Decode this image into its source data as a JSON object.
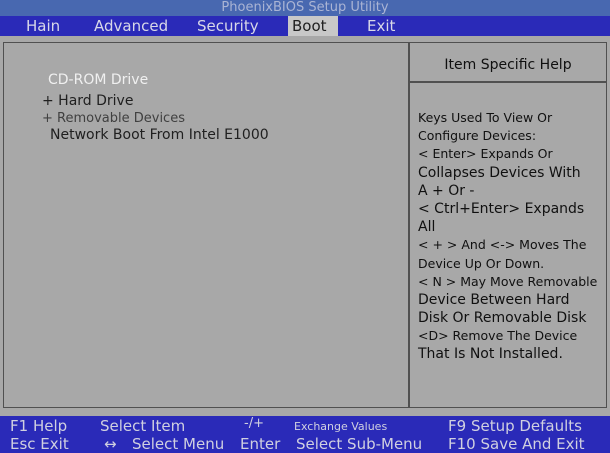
{
  "window": {
    "title": "PhoenixBIOS Setup Utility"
  },
  "menu": {
    "items": [
      {
        "label": "Hain"
      },
      {
        "label": "Advanced"
      },
      {
        "label": "Security"
      },
      {
        "label": "Boot"
      },
      {
        "label": "Exit"
      }
    ],
    "active": "Boot"
  },
  "boot_list": {
    "items": [
      {
        "label": "CD-ROM Drive"
      },
      {
        "label": "+ Hard Drive"
      },
      {
        "label": "+ Removable Devices"
      },
      {
        "label": "Network Boot From Intel E1000"
      }
    ]
  },
  "help": {
    "header": "Item Specific Help",
    "lines": [
      "Keys Used To View Or",
      "Configure Devices:",
      "< Enter> Expands Or",
      "Collapses Devices With",
      "A + Or -",
      "< Ctrl+Enter> Expands",
      "All",
      "< + > And <-> Moves The",
      "Device Up Or Down.",
      "< N > May Move Removable",
      "Device Between Hard",
      "Disk Or Removable Disk",
      "<D> Remove The Device",
      "That Is Not Installed."
    ]
  },
  "status": {
    "row1": {
      "f1": "F1 Help",
      "select_item": "Select Item",
      "plus_minus": "-/+",
      "change_values": "Exchange Values",
      "f9": "F9 Setup Defaults"
    },
    "row2": {
      "esc": "Esc Exit",
      "arrows": "↔",
      "select_menu": "Select Menu",
      "enter": "Enter",
      "select_submenu": "Select Sub-Menu",
      "f10": "F10 Save And Exit"
    }
  },
  "colors": {
    "bar_blue": "#2a2ab8",
    "title_blue": "#4868b0",
    "panel_gray": "#a8a8a8"
  }
}
